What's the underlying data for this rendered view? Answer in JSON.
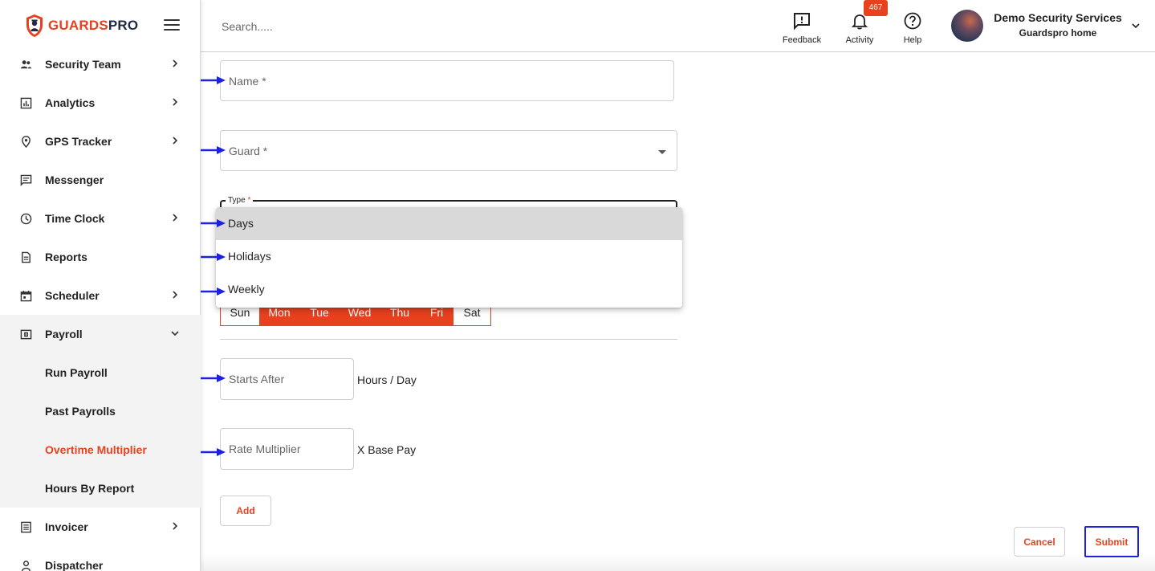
{
  "brand": {
    "part1": "GUARDS",
    "part2": "PRO"
  },
  "header": {
    "search_placeholder": "Search.....",
    "feedback_label": "Feedback",
    "activity_label": "Activity",
    "activity_count": "467",
    "help_label": "Help",
    "org_name": "Demo Security Services",
    "org_sub": "Guardspro home"
  },
  "sidebar": {
    "items": [
      {
        "label": "Security Team",
        "icon": "team-icon"
      },
      {
        "label": "Analytics",
        "icon": "analytics-icon"
      },
      {
        "label": "GPS Tracker",
        "icon": "location-pin-icon"
      },
      {
        "label": "Messenger",
        "icon": "message-icon"
      },
      {
        "label": "Time Clock",
        "icon": "clock-icon"
      },
      {
        "label": "Reports",
        "icon": "document-icon"
      },
      {
        "label": "Scheduler",
        "icon": "calendar-icon"
      },
      {
        "label": "Payroll",
        "icon": "payroll-icon"
      }
    ],
    "payroll_sub": [
      {
        "label": "Run Payroll"
      },
      {
        "label": "Past Payrolls"
      },
      {
        "label": "Overtime Multiplier"
      },
      {
        "label": "Hours By Report"
      }
    ],
    "after": [
      {
        "label": "Invoicer",
        "icon": "invoice-icon"
      },
      {
        "label": "Dispatcher",
        "icon": "dispatcher-icon"
      }
    ]
  },
  "form": {
    "name_placeholder": "Name *",
    "guard_placeholder": "Guard *",
    "type_label": "Type",
    "type_required": "*",
    "type_options": [
      "Days",
      "Holidays",
      "Weekly"
    ],
    "days": [
      "Sun",
      "Mon",
      "Tue",
      "Wed",
      "Thu",
      "Fri",
      "Sat"
    ],
    "starts_after_placeholder": "Starts After",
    "starts_after_suffix": "Hours / Day",
    "rate_placeholder": "Rate Multiplier",
    "rate_suffix": "X Base Pay",
    "add_label": "Add"
  },
  "actions": {
    "cancel_label": "Cancel",
    "submit_label": "Submit"
  },
  "colors": {
    "accent": "#e8411e",
    "arrow": "#1d22e0",
    "focus": "#1d22e0"
  }
}
